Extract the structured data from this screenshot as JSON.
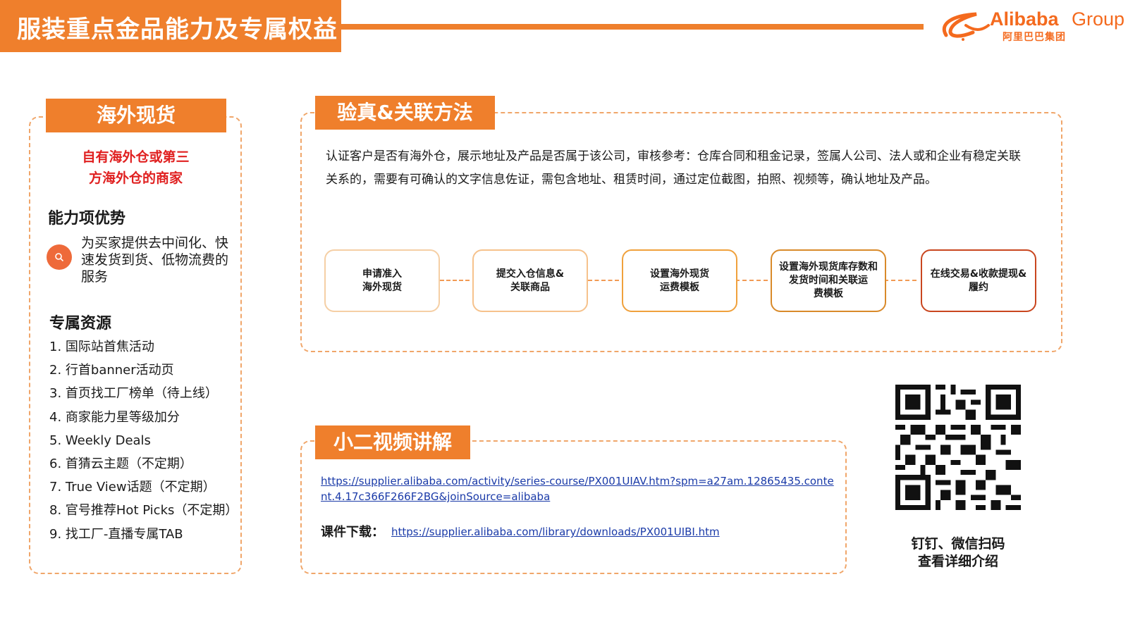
{
  "header": {
    "title": "服装重点金品能力及专属权益",
    "logo_word": "Alibaba",
    "logo_group": "Group",
    "logo_cn": "阿里巴巴集团"
  },
  "left_panel": {
    "tag": "海外现货",
    "merchant_line1": "自有海外仓或第三",
    "merchant_line2": "方海外仓的商家",
    "ability_heading": "能力项优势",
    "ability_text": "为买家提供去中间化、快速发货到货、低物流费的服务",
    "resources_heading": "专属资源",
    "resources": [
      "1. 国际站首焦活动",
      "2. 行首banner活动页",
      "3. 首页找工厂榜单（待上线）",
      "4. 商家能力星等级加分",
      "5. Weekly Deals",
      "6. 首猜云主题（不定期）",
      "7. True View话题（不定期）",
      "8. 官号推荐Hot Picks（不定期）",
      "9. 找工厂-直播专属TAB"
    ]
  },
  "verify": {
    "tag": "验真&关联方法",
    "description": "认证客户是否有海外仓，展示地址及产品是否属于该公司，审核参考：仓库合同和租金记录，签属人公司、法人或和企业有稳定关联关系的，需要有可确认的文字信息佐证，需包含地址、租赁时间，通过定位截图，拍照、视频等，确认地址及产品。",
    "steps": [
      {
        "line1": "申请准入",
        "line2": "海外现货"
      },
      {
        "line1": "提交入仓信息&",
        "line2": "关联商品"
      },
      {
        "line1": "设置海外现货",
        "line2": "运费模板"
      },
      {
        "line1": "设置海外现货库存数和发货时间和关联运",
        "line2": "费模板"
      },
      {
        "line1": "在线交易&收款提现&",
        "line2": "履约"
      }
    ]
  },
  "video": {
    "tag": "小二视频讲解",
    "link1": "https://supplier.alibaba.com/activity/series-course/PX001UIAV.htm?spm=a27am.12865435.content.4.17c366F266F2BG&joinSource=alibaba",
    "download_label": "课件下载：",
    "link2": "https://supplier.alibaba.com/library/downloads/PX001UIBI.htm"
  },
  "qr": {
    "line1": "钉钉、微信扫码",
    "line2": "查看详细介绍"
  },
  "colors": {
    "accent": "#ef7f2c",
    "merchant_red": "#e02020",
    "link": "#1a3aa8",
    "step_borders": [
      "#f5cfa5",
      "#f6c28c",
      "#f0a13c",
      "#d98a2a",
      "#c9461f"
    ]
  }
}
